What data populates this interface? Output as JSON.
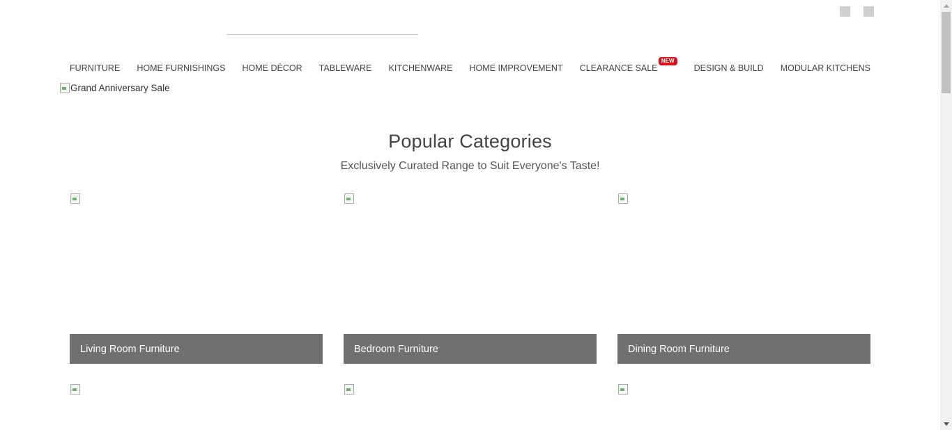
{
  "header": {
    "icons": [
      "account-icon",
      "cart-icon"
    ]
  },
  "nav": {
    "items": [
      {
        "label": "FURNITURE"
      },
      {
        "label": "HOME FURNISHINGS"
      },
      {
        "label": "HOME DÉCOR"
      },
      {
        "label": "TABLEWARE"
      },
      {
        "label": "KITCHENWARE"
      },
      {
        "label": "HOME IMPROVEMENT"
      },
      {
        "label": "CLEARANCE SALE",
        "badge": "NEW"
      },
      {
        "label": "DESIGN & BUILD"
      },
      {
        "label": "MODULAR KITCHENS"
      }
    ],
    "badge_color": "#d6121b"
  },
  "banner": {
    "alt_text": "Grand Anniversary Sale"
  },
  "popular": {
    "title": "Popular Categories",
    "subtitle": "Exclusively Curated Range to Suit Everyone's Taste!",
    "label_bg": "#707070",
    "categories": [
      {
        "label": "Living Room Furniture"
      },
      {
        "label": "Bedroom Furniture"
      },
      {
        "label": "Dining Room Furniture"
      }
    ]
  }
}
